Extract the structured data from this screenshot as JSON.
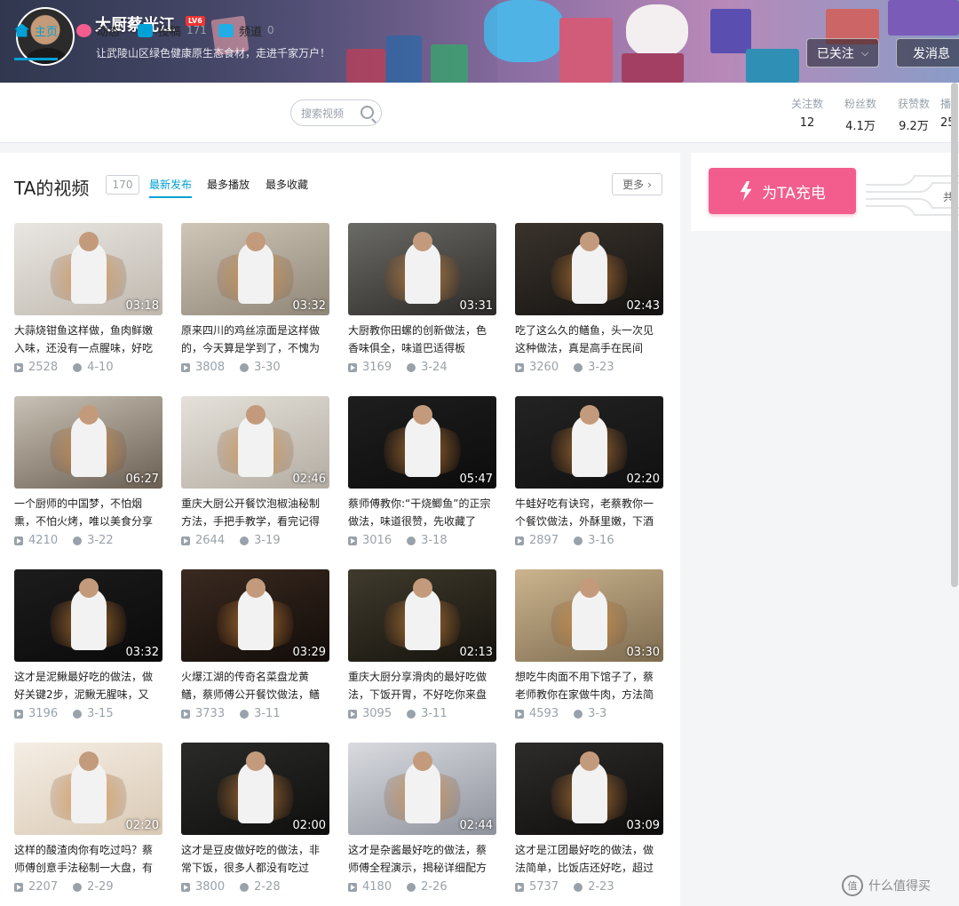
{
  "profile": {
    "name": "大厨蔡光江",
    "level": "LV6",
    "sign": "让武陵山区绿色健康原生态食材，走进千家万户！",
    "follow_label": "已关注",
    "message_label": "发消息"
  },
  "nav": {
    "tabs": [
      {
        "label": "主页",
        "count": ""
      },
      {
        "label": "动态",
        "count": ""
      },
      {
        "label": "投稿",
        "count": "171"
      },
      {
        "label": "频道",
        "count": "0"
      }
    ],
    "search_placeholder": "搜索视频",
    "stats": [
      {
        "label": "关注数",
        "value": "12"
      },
      {
        "label": "粉丝数",
        "value": "4.1万"
      },
      {
        "label": "获赞数",
        "value": "9.2万"
      },
      {
        "label": "播",
        "value": "25"
      }
    ]
  },
  "videos_section": {
    "title": "TA的视频",
    "count": "170",
    "sort_tabs": [
      "最新发布",
      "最多播放",
      "最多收藏"
    ],
    "more_label": "更多"
  },
  "videos": [
    {
      "title": "大蒜烧钳鱼这样做，鱼肉鲜嫩入味，还没有一点腥味，好吃",
      "duration": "03:18",
      "plays": "2528",
      "date": "4-10",
      "colors": [
        "#e9e6e2",
        "#bfb8ae"
      ]
    },
    {
      "title": "原来四川的鸡丝凉面是这样做的，今天算是学到了，不愧为",
      "duration": "03:32",
      "plays": "3808",
      "date": "3-30",
      "colors": [
        "#cfc6b8",
        "#8f8677"
      ]
    },
    {
      "title": "大厨教你田螺的创新做法，色香味俱全，味道巴适得板",
      "duration": "03:31",
      "plays": "3169",
      "date": "3-24",
      "colors": [
        "#6a6a66",
        "#2d2b28"
      ]
    },
    {
      "title": "吃了这么久的鳝鱼，头一次见这种做法，真是高手在民间",
      "duration": "02:43",
      "plays": "3260",
      "date": "3-23",
      "colors": [
        "#3a332c",
        "#141210"
      ]
    },
    {
      "title": "一个厨师的中国梦，不怕烟熏，不怕火烤，唯以美食分享",
      "duration": "06:27",
      "plays": "4210",
      "date": "3-22",
      "colors": [
        "#c9c1b5",
        "#6b5f53"
      ]
    },
    {
      "title": "重庆大厨公开餐饮泡椒油秘制方法，手把手教学，看完记得",
      "duration": "02:46",
      "plays": "2644",
      "date": "3-19",
      "colors": [
        "#e5e1da",
        "#b3aca2"
      ]
    },
    {
      "title": "蔡师傅教你:“干烧鲫鱼”的正宗做法，味道很赞，先收藏了",
      "duration": "05:47",
      "plays": "3016",
      "date": "3-18",
      "colors": [
        "#1e1e1e",
        "#0c0c0c"
      ]
    },
    {
      "title": "牛蛙好吃有诀窍，老蔡教你一个餐饮做法，外酥里嫩，下酒",
      "duration": "02:20",
      "plays": "2897",
      "date": "3-16",
      "colors": [
        "#232323",
        "#101010"
      ]
    },
    {
      "title": "这才是泥鳅最好吃的做法，做好关键2步，泥鳅无腥味，又",
      "duration": "03:32",
      "plays": "3196",
      "date": "3-15",
      "colors": [
        "#1c1c1c",
        "#0a0a0a"
      ]
    },
    {
      "title": "火爆江湖的传奇名菜盘龙黄鳝，蔡师傅公开餐饮做法，鳝",
      "duration": "03:29",
      "plays": "3733",
      "date": "3-11",
      "colors": [
        "#3a2a20",
        "#120c09"
      ]
    },
    {
      "title": "重庆大厨分享滑肉的最好吃做法，下饭开胃，不好吃你来盘",
      "duration": "02:13",
      "plays": "3095",
      "date": "3-11",
      "colors": [
        "#3f3a2c",
        "#15130e"
      ]
    },
    {
      "title": "想吃牛肉面不用下馆子了，蔡老师教你在家做牛肉，方法简",
      "duration": "03:30",
      "plays": "4593",
      "date": "3-3",
      "colors": [
        "#cbb48e",
        "#7d6b4f"
      ]
    },
    {
      "title": "这样的酸渣肉你有吃过吗？蔡师傅创意手法秘制一大盘，有",
      "duration": "02:20",
      "plays": "2207",
      "date": "2-29",
      "colors": [
        "#f5eee5",
        "#d9c9b4"
      ]
    },
    {
      "title": "这才是豆皮做好吃的做法，非常下饭，很多人都没有吃过",
      "duration": "02:00",
      "plays": "3800",
      "date": "2-28",
      "colors": [
        "#2a2a28",
        "#0f0f0e"
      ]
    },
    {
      "title": "这才是杂酱最好吃的做法，蔡师傅全程演示，揭秘详细配方",
      "duration": "02:44",
      "plays": "4180",
      "date": "2-26",
      "colors": [
        "#d9dbe0",
        "#8e929c"
      ]
    },
    {
      "title": "这才是江团最好吃的做法，做法简单，比饭店还好吃，超过",
      "duration": "03:09",
      "plays": "5737",
      "date": "2-23",
      "colors": [
        "#2e2c2a",
        "#0e0d0c"
      ]
    }
  ],
  "side": {
    "charge_label": "为TA充电",
    "partial_text": "共"
  },
  "watermark": {
    "icon_text": "值",
    "text": "什么值得买"
  },
  "colors": {
    "accent": "#00a1d6",
    "charge": "#f25d8e",
    "muted": "#99a2aa"
  }
}
